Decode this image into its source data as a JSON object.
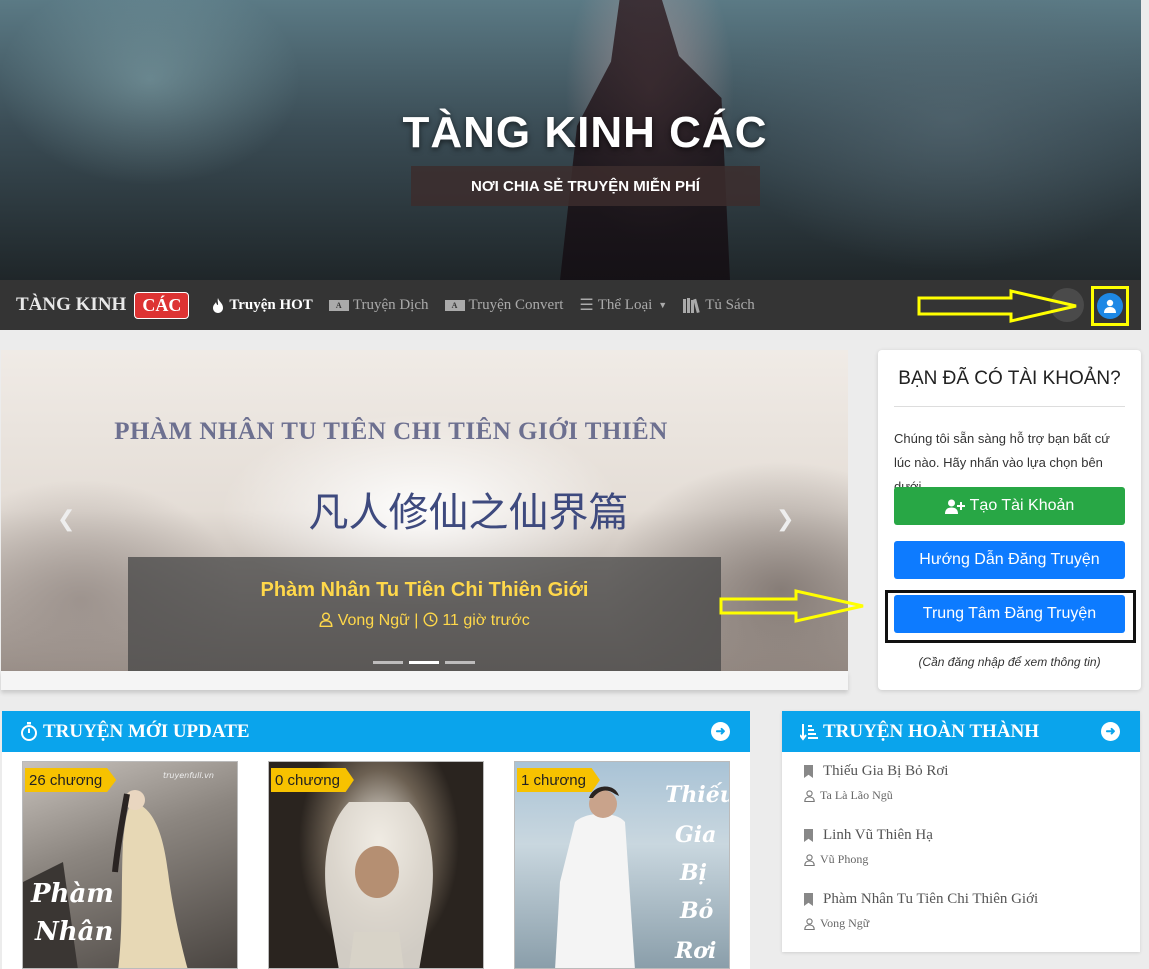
{
  "hero": {
    "title": "TÀNG KINH CÁC",
    "subtitle": "NƠI CHIA SẺ TRUYỆN MIỄN PHÍ"
  },
  "navbar": {
    "brand": "TÀNG KINH",
    "brand_badge": "CÁC",
    "items": [
      {
        "label": "Truyện HOT",
        "icon": "fire-icon"
      },
      {
        "label": "Truyện Dịch",
        "icon": "translate-icon"
      },
      {
        "label": "Truyện Convert",
        "icon": "convert-icon"
      },
      {
        "label": "Thể Loại",
        "icon": "list-icon"
      },
      {
        "label": "Tủ Sách",
        "icon": "bookshelf-icon"
      }
    ]
  },
  "carousel": {
    "banner_title_en": "PHÀM NHÂN TU TIÊN CHI TIÊN GIỚI THIÊN",
    "banner_title_cn": "凡人修仙之仙界篇",
    "caption_title": "Phàm Nhân Tu Tiên Chi Thiên Giới",
    "caption_author": "Vong Ngữ",
    "caption_separator": "|",
    "caption_time": "11 giờ trước",
    "slide_count": 3,
    "active_slide": 2
  },
  "account": {
    "title": "BẠN ĐÃ CÓ TÀI KHOẢN?",
    "description": "Chúng tôi sẵn sàng hỗ trợ bạn bất cứ lúc nào. Hãy nhấn vào lựa chọn bên dưới.",
    "create_label": "Tạo Tài Khoản",
    "guide_label": "Hướng Dẫn Đăng Truyện",
    "center_label": "Trung Tâm Đăng Truyện",
    "note": "(Cần đăng nhập để xem thông tin)"
  },
  "new_updates": {
    "title": "TRUYỆN MỚI UPDATE",
    "books": [
      {
        "chapters": "26 chương",
        "cover_text": "Phàm Nhân Tu"
      },
      {
        "chapters": "0 chương",
        "cover_text": ""
      },
      {
        "chapters": "1 chương",
        "cover_text": "Thiếu Gia Bị Bỏ Rơi"
      }
    ],
    "watermark": "truyenfull.vn"
  },
  "completed": {
    "title": "TRUYỆN HOÀN THÀNH",
    "items": [
      {
        "title": "Thiếu Gia Bị Bỏ Rơi",
        "author": "Ta Là Lão Ngũ"
      },
      {
        "title": "Linh Vũ Thiên Hạ",
        "author": "Vũ Phong"
      },
      {
        "title": "Phàm Nhân Tu Tiên Chi Thiên Giới",
        "author": "Vong Ngữ"
      }
    ]
  },
  "colors": {
    "accent_blue": "#0aa4ec",
    "button_blue": "#0d7bff",
    "button_green": "#28a745",
    "badge_red": "#dd3333",
    "caption_yellow": "#ffd84a",
    "annotation_yellow": "#ffff00"
  }
}
